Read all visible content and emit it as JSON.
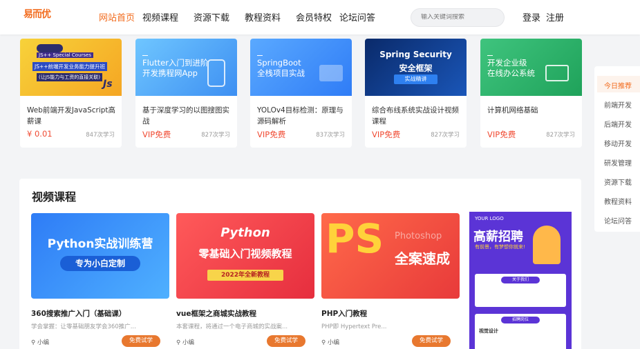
{
  "header": {
    "logo": "易而优",
    "nav": [
      "网站首页",
      "视频课程",
      "资源下载",
      "教程资料",
      "会员特权",
      "论坛问答"
    ],
    "search_placeholder": "输入关键词搜索",
    "login": "登录",
    "register": "注册"
  },
  "top_courses": [
    {
      "title": "Web前端开发JavaScript高薪课",
      "price": "¥ 0.01",
      "learners": "847次学习",
      "thumb_text": [
        "JS++ Special Courses",
        "JS++前端开发业务能力提升班",
        "(让JS能力与工资的直接关联)",
        "Js"
      ]
    },
    {
      "title": "基于深度学习的以图搜图实战",
      "price": "VIP免费",
      "learners": "827次学习",
      "thumb_text": [
        "Flutter入门到进阶",
        "开发携程网App"
      ]
    },
    {
      "title": "YOLOv4目标检测：原理与源码解析",
      "price": "VIP免费",
      "learners": "837次学习",
      "thumb_text": [
        "SpringBoot",
        "全栈项目实战"
      ]
    },
    {
      "title": "综合布线系统实战设计视频课程",
      "price": "VIP免费",
      "learners": "827次学习",
      "thumb_text": [
        "Spring Security",
        "安全框架",
        "实战精讲"
      ]
    },
    {
      "title": "计算机网络基础",
      "price": "VIP免费",
      "learners": "827次学习",
      "thumb_text": [
        "开发企业级",
        "在线办公系统"
      ]
    }
  ],
  "side_nav": [
    "今日推荐",
    "前端开发",
    "后端开发",
    "移动开发",
    "研发管理",
    "资源下载",
    "教程资料",
    "论坛问答"
  ],
  "video_section": {
    "title": "视频课程",
    "items": [
      {
        "title": "360搜索推广入门（基础课）",
        "desc": "学会掌握：让零基础朋友学会360推广...",
        "author": "小编",
        "trial": "免费试学",
        "thumb_text": [
          "Python实战训练营",
          "专为小白定制"
        ]
      },
      {
        "title": "vue框架之商城实战教程",
        "desc": "本套课程，将通过一个电子商城的实战案...",
        "author": "小编",
        "trial": "免费试学",
        "thumb_text": [
          "Python",
          "零基础入门视频教程",
          "2022年全新教程"
        ]
      },
      {
        "title": "PHP入门教程",
        "desc": "PHP即 Hypertext Pre...",
        "author": "小编",
        "trial": "免费试学",
        "thumb_text": [
          "PS",
          "Photoshop",
          "全案速成"
        ]
      }
    ],
    "poster": {
      "logo": "YOUR LOGO",
      "title": "高薪招聘",
      "subtitle": "有前景，有梦想你就来!",
      "about": "关于我们",
      "jobs": "招聘岗位",
      "job_title": "视觉设计"
    }
  },
  "colors": {
    "accent": "#f26b1d",
    "price": "#f04a32",
    "trial": "#e8782f"
  }
}
